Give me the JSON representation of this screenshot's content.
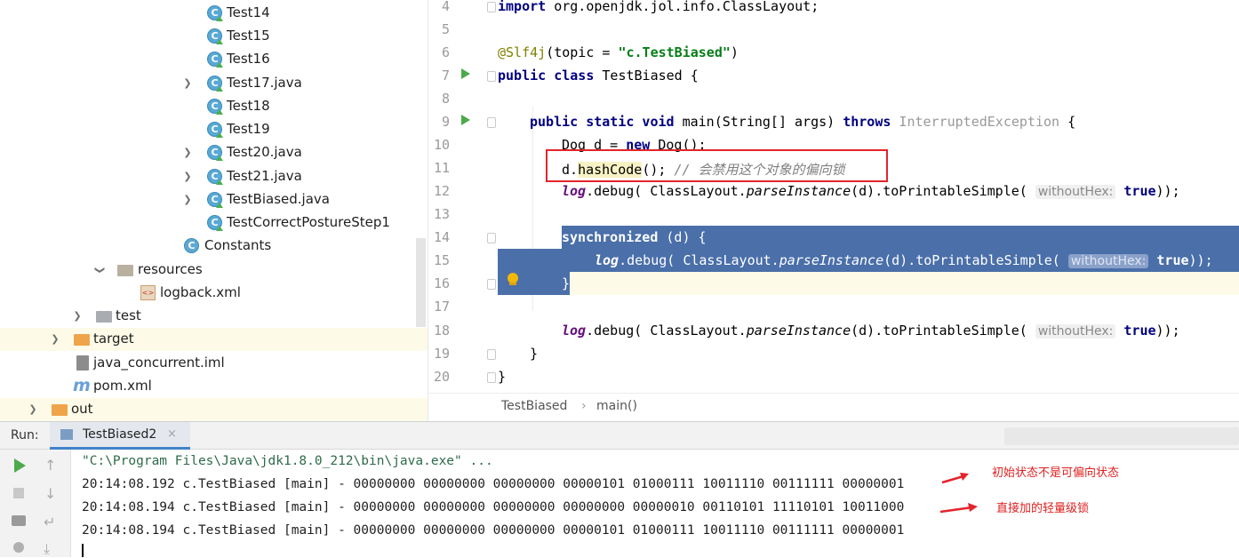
{
  "tree": {
    "items": [
      {
        "label": "Test14",
        "icon": "java-class-icon"
      },
      {
        "label": "Test15",
        "icon": "java-class-icon"
      },
      {
        "label": "Test16",
        "icon": "java-class-icon"
      },
      {
        "label": "Test17.java",
        "icon": "java-class-icon"
      },
      {
        "label": "Test18",
        "icon": "java-class-icon"
      },
      {
        "label": "Test19",
        "icon": "java-class-icon"
      },
      {
        "label": "Test20.java",
        "icon": "java-class-icon"
      },
      {
        "label": "Test21.java",
        "icon": "java-class-icon"
      },
      {
        "label": "TestBiased.java",
        "icon": "java-class-icon"
      },
      {
        "label": "TestCorrectPostureStep1",
        "icon": "java-class-icon"
      },
      {
        "label": "Constants",
        "icon": "java-class-icon"
      },
      {
        "label": "resources",
        "icon": "resources-folder-icon"
      },
      {
        "label": "logback.xml",
        "icon": "xml-file-icon"
      },
      {
        "label": "test",
        "icon": "folder-icon"
      },
      {
        "label": "target",
        "icon": "folder-icon"
      },
      {
        "label": "java_concurrent.iml",
        "icon": "iml-file-icon"
      },
      {
        "label": "pom.xml",
        "icon": "maven-icon"
      },
      {
        "label": "out",
        "icon": "folder-icon"
      }
    ]
  },
  "editor": {
    "line_numbers": [
      "4",
      "5",
      "6",
      "7",
      "8",
      "9",
      "10",
      "11",
      "12",
      "13",
      "14",
      "15",
      "16",
      "17",
      "18",
      "19",
      "20"
    ],
    "l4": {
      "kw": "import",
      "rest": " org.openjdk.jol.info.ClassLayout;"
    },
    "l6": {
      "ann": "@Slf4j",
      "a": "(topic = ",
      "str": "\"c.TestBiased\"",
      "b": ")"
    },
    "l7": {
      "kw": "public class",
      "rest": " TestBiased {"
    },
    "l9": {
      "kw1": "public static void",
      "a": " main(String[] args) ",
      "kw2": "throws",
      "exc": " InterruptedException",
      "b": " {"
    },
    "l10": {
      "a": "Dog d = ",
      "kw": "new",
      "b": " Dog();"
    },
    "l11": {
      "a": "d.",
      "method": "hashCode",
      "b": "(); ",
      "comment": "// 会禁用这个对象的偏向锁"
    },
    "log_call": {
      "log": "log",
      "a": ".debug( ClassLayout.",
      "parse": "parseInstance",
      "b": "(d).toPrintableSimple( ",
      "hint": "withoutHex:",
      "kw": "true",
      "c": "));"
    },
    "l14": {
      "kw": "synchronized",
      "rest": " (d) {"
    },
    "l16": "}",
    "l19": "}",
    "l20": "}",
    "breadcrumb": {
      "class": "TestBiased",
      "sep": "›",
      "method": "main()"
    }
  },
  "run": {
    "label": "Run:",
    "tab": "TestBiased2",
    "tab_close": "×",
    "command": "\"C:\\Program Files\\Java\\jdk1.8.0_212\\bin\\java.exe\" ...",
    "lines": [
      "20:14:08.192 c.TestBiased [main] - 00000000 00000000 00000000 00000101 01000111 10011110 00111111 00000001",
      "20:14:08.194 c.TestBiased [main] - 00000000 00000000 00000000 00000000 00000010 00110101 11110101 10011000",
      "20:14:08.194 c.TestBiased [main] - 00000000 00000000 00000000 00000101 01000111 10011110 00111111 00000001"
    ],
    "notes": [
      "初始状态不是可偏向状态",
      "直接加的轻量级锁"
    ]
  }
}
